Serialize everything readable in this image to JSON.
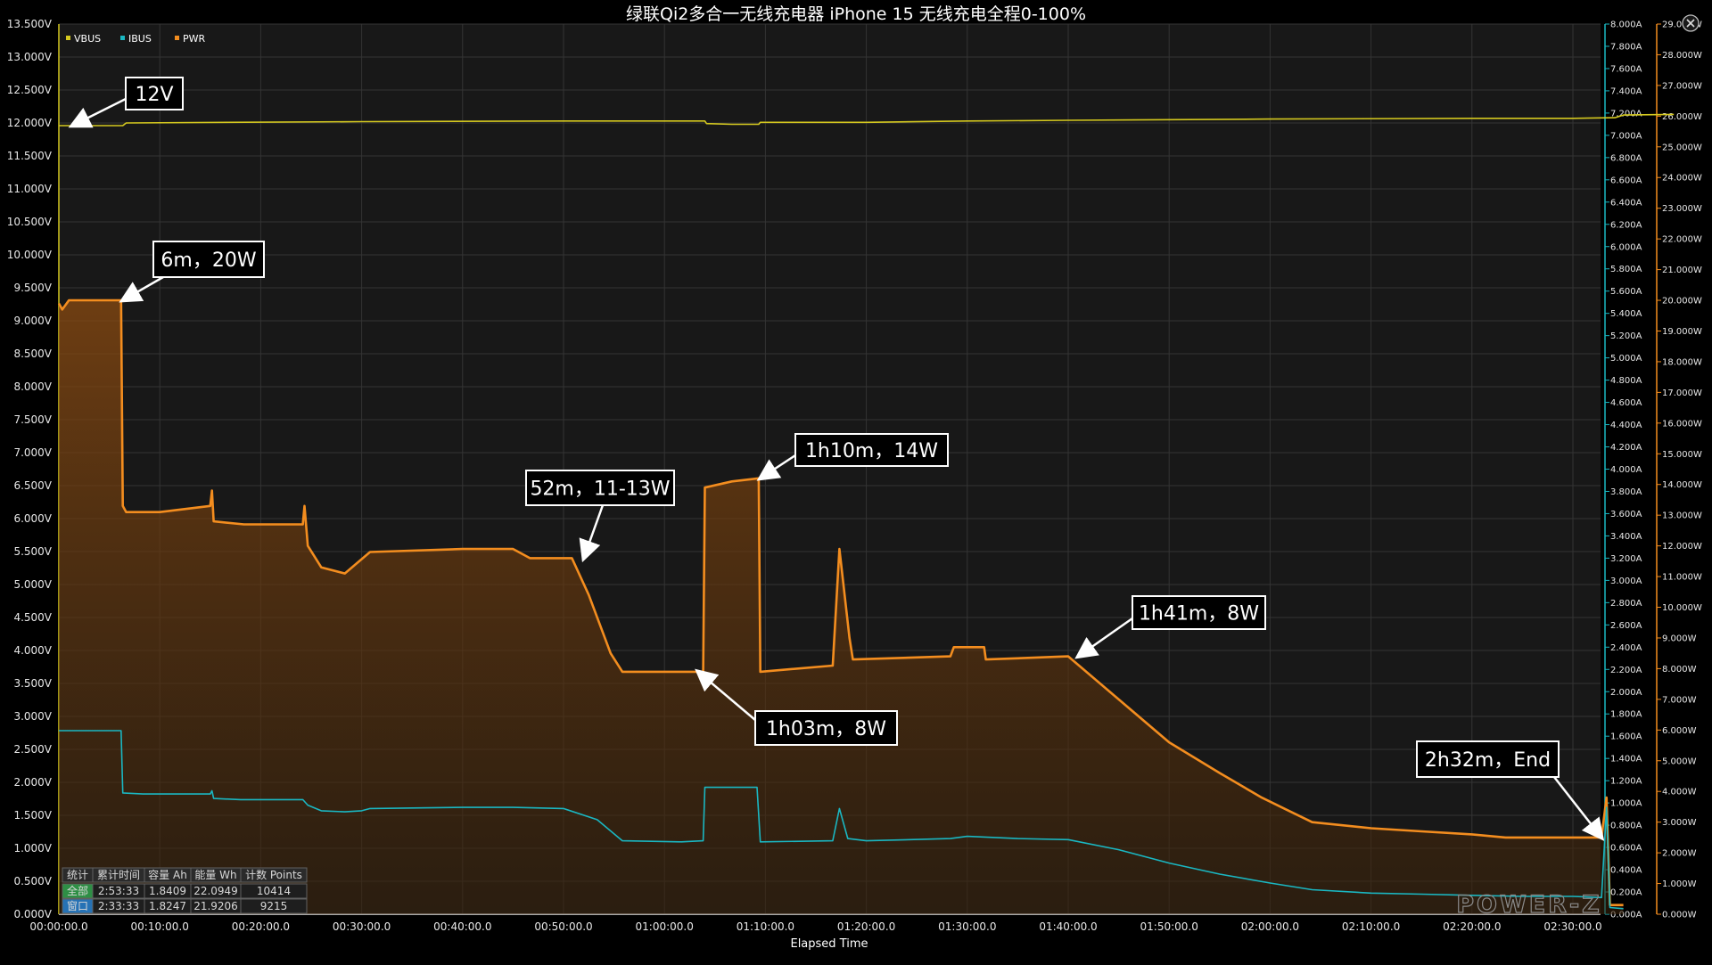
{
  "chart_data": {
    "type": "line",
    "title": "绿联Qi2多合一无线充电器 iPhone 15 无线充电全程0-100%",
    "xlabel": "Elapsed Time",
    "x_unit": "seconds",
    "xlim": [
      0,
      9700
    ],
    "x_ticks": [
      {
        "v": 0,
        "label": "00:00:00.0"
      },
      {
        "v": 600,
        "label": "00:10:00.0"
      },
      {
        "v": 1200,
        "label": "00:20:00.0"
      },
      {
        "v": 1800,
        "label": "00:30:00.0"
      },
      {
        "v": 2400,
        "label": "00:40:00.0"
      },
      {
        "v": 3000,
        "label": "00:50:00.0"
      },
      {
        "v": 3600,
        "label": "01:00:00.0"
      },
      {
        "v": 4200,
        "label": "01:10:00.0"
      },
      {
        "v": 4800,
        "label": "01:20:00.0"
      },
      {
        "v": 5400,
        "label": "01:30:00.0"
      },
      {
        "v": 6000,
        "label": "01:40:00.0"
      },
      {
        "v": 6600,
        "label": "01:50:00.0"
      },
      {
        "v": 7200,
        "label": "02:00:00.0"
      },
      {
        "v": 7800,
        "label": "02:10:00.0"
      },
      {
        "v": 8400,
        "label": "02:20:00.0"
      },
      {
        "v": 9000,
        "label": "02:30:00.0"
      }
    ],
    "y_left": {
      "unit": "V",
      "range": [
        0,
        13.5
      ],
      "step": 0.5,
      "decimals": 3
    },
    "y_mid": {
      "unit": "A",
      "range": [
        0,
        8.0
      ],
      "step": 0.2,
      "decimals": 3
    },
    "y_right": {
      "unit": "W",
      "range": [
        0,
        29.0
      ],
      "step": 1.0,
      "decimals": 3
    },
    "grid": true,
    "legend_position": "top-left",
    "series": [
      {
        "name": "VBUS",
        "axis": "V",
        "color": "#d4c81f",
        "points": [
          [
            0,
            11.96
          ],
          [
            380,
            11.96
          ],
          [
            400,
            12.0
          ],
          [
            1800,
            12.02
          ],
          [
            3000,
            12.03
          ],
          [
            3600,
            12.03
          ],
          [
            3840,
            12.03
          ],
          [
            3850,
            11.99
          ],
          [
            4000,
            11.98
          ],
          [
            4160,
            11.98
          ],
          [
            4170,
            12.01
          ],
          [
            4800,
            12.01
          ],
          [
            5400,
            12.03
          ],
          [
            6000,
            12.04
          ],
          [
            7200,
            12.06
          ],
          [
            8400,
            12.07
          ],
          [
            9000,
            12.07
          ],
          [
            9250,
            12.08
          ],
          [
            9300,
            12.12
          ],
          [
            9600,
            12.13
          ]
        ]
      },
      {
        "name": "IBUS",
        "axis": "A",
        "color": "#1ab7c2",
        "points": [
          [
            0,
            1.65
          ],
          [
            370,
            1.65
          ],
          [
            380,
            1.09
          ],
          [
            500,
            1.08
          ],
          [
            900,
            1.08
          ],
          [
            910,
            1.11
          ],
          [
            920,
            1.04
          ],
          [
            1080,
            1.03
          ],
          [
            1450,
            1.03
          ],
          [
            1480,
            0.98
          ],
          [
            1560,
            0.93
          ],
          [
            1700,
            0.92
          ],
          [
            1800,
            0.93
          ],
          [
            1850,
            0.95
          ],
          [
            2400,
            0.96
          ],
          [
            2700,
            0.96
          ],
          [
            3000,
            0.95
          ],
          [
            3200,
            0.85
          ],
          [
            3350,
            0.66
          ],
          [
            3700,
            0.65
          ],
          [
            3830,
            0.66
          ],
          [
            3840,
            1.14
          ],
          [
            4150,
            1.14
          ],
          [
            4170,
            0.65
          ],
          [
            4600,
            0.66
          ],
          [
            4640,
            0.95
          ],
          [
            4690,
            0.68
          ],
          [
            4800,
            0.66
          ],
          [
            5300,
            0.68
          ],
          [
            5400,
            0.7
          ],
          [
            5700,
            0.68
          ],
          [
            6000,
            0.67
          ],
          [
            6300,
            0.58
          ],
          [
            6600,
            0.46
          ],
          [
            6900,
            0.36
          ],
          [
            7200,
            0.28
          ],
          [
            7450,
            0.22
          ],
          [
            7800,
            0.19
          ],
          [
            8100,
            0.18
          ],
          [
            8400,
            0.17
          ],
          [
            8700,
            0.16
          ],
          [
            9000,
            0.16
          ],
          [
            9170,
            0.15
          ],
          [
            9200,
            0.96
          ],
          [
            9220,
            0.06
          ],
          [
            9300,
            0.05
          ]
        ]
      },
      {
        "name": "PWR",
        "axis": "W",
        "color": "#f38d1f",
        "points": [
          [
            0,
            19.9
          ],
          [
            20,
            19.7
          ],
          [
            60,
            20.0
          ],
          [
            370,
            20.0
          ],
          [
            380,
            13.3
          ],
          [
            400,
            13.1
          ],
          [
            600,
            13.1
          ],
          [
            900,
            13.3
          ],
          [
            910,
            13.8
          ],
          [
            920,
            12.8
          ],
          [
            1100,
            12.7
          ],
          [
            1450,
            12.7
          ],
          [
            1460,
            13.3
          ],
          [
            1480,
            12.0
          ],
          [
            1560,
            11.3
          ],
          [
            1700,
            11.1
          ],
          [
            1850,
            11.8
          ],
          [
            2400,
            11.9
          ],
          [
            2700,
            11.9
          ],
          [
            2800,
            11.6
          ],
          [
            3050,
            11.6
          ],
          [
            3150,
            10.4
          ],
          [
            3280,
            8.5
          ],
          [
            3350,
            7.9
          ],
          [
            3500,
            7.9
          ],
          [
            3830,
            7.9
          ],
          [
            3840,
            13.9
          ],
          [
            4000,
            14.1
          ],
          [
            4160,
            14.2
          ],
          [
            4170,
            7.9
          ],
          [
            4600,
            8.1
          ],
          [
            4640,
            11.9
          ],
          [
            4700,
            9.0
          ],
          [
            4720,
            8.3
          ],
          [
            5300,
            8.4
          ],
          [
            5320,
            8.7
          ],
          [
            5500,
            8.7
          ],
          [
            5510,
            8.3
          ],
          [
            6000,
            8.4
          ],
          [
            6300,
            7.0
          ],
          [
            6600,
            5.6
          ],
          [
            6900,
            4.6
          ],
          [
            7150,
            3.8
          ],
          [
            7300,
            3.4
          ],
          [
            7450,
            3.0
          ],
          [
            7800,
            2.8
          ],
          [
            8100,
            2.7
          ],
          [
            8400,
            2.6
          ],
          [
            8600,
            2.5
          ],
          [
            9000,
            2.5
          ],
          [
            9170,
            2.5
          ],
          [
            9200,
            3.8
          ],
          [
            9220,
            0.3
          ],
          [
            9300,
            0.3
          ]
        ]
      }
    ],
    "annotations": [
      {
        "label": "12V",
        "x": 80,
        "axis": "V",
        "y": 11.96
      },
      {
        "label": "6m，20W",
        "x": 380,
        "axis": "W",
        "y": 20.0
      },
      {
        "label": "52m，11-13W",
        "x": 3120,
        "axis": "W",
        "y": 11.6
      },
      {
        "label": "1h03m，8W",
        "x": 3800,
        "axis": "W",
        "y": 7.9
      },
      {
        "label": "1h10m，14W",
        "x": 4170,
        "axis": "W",
        "y": 14.2
      },
      {
        "label": "1h41m，8W",
        "x": 6060,
        "axis": "W",
        "y": 8.4
      },
      {
        "label": "2h32m，End",
        "x": 9170,
        "axis": "W",
        "y": 2.5
      }
    ]
  },
  "stats_table": {
    "headers": [
      "统计",
      "累计时间",
      "容量 Ah",
      "能量 Wh",
      "计数 Points"
    ],
    "rows": [
      [
        "全部",
        "2:53:33",
        "1.8409",
        "22.0949",
        "10414"
      ],
      [
        "窗口",
        "2:33:33",
        "1.8247",
        "21.9206",
        "9215"
      ]
    ]
  },
  "brand": "POWER-Z",
  "colors": {
    "background": "#000000",
    "plot": "#181818",
    "grid": "#3a3a3a",
    "accent": "#f38d1f"
  }
}
